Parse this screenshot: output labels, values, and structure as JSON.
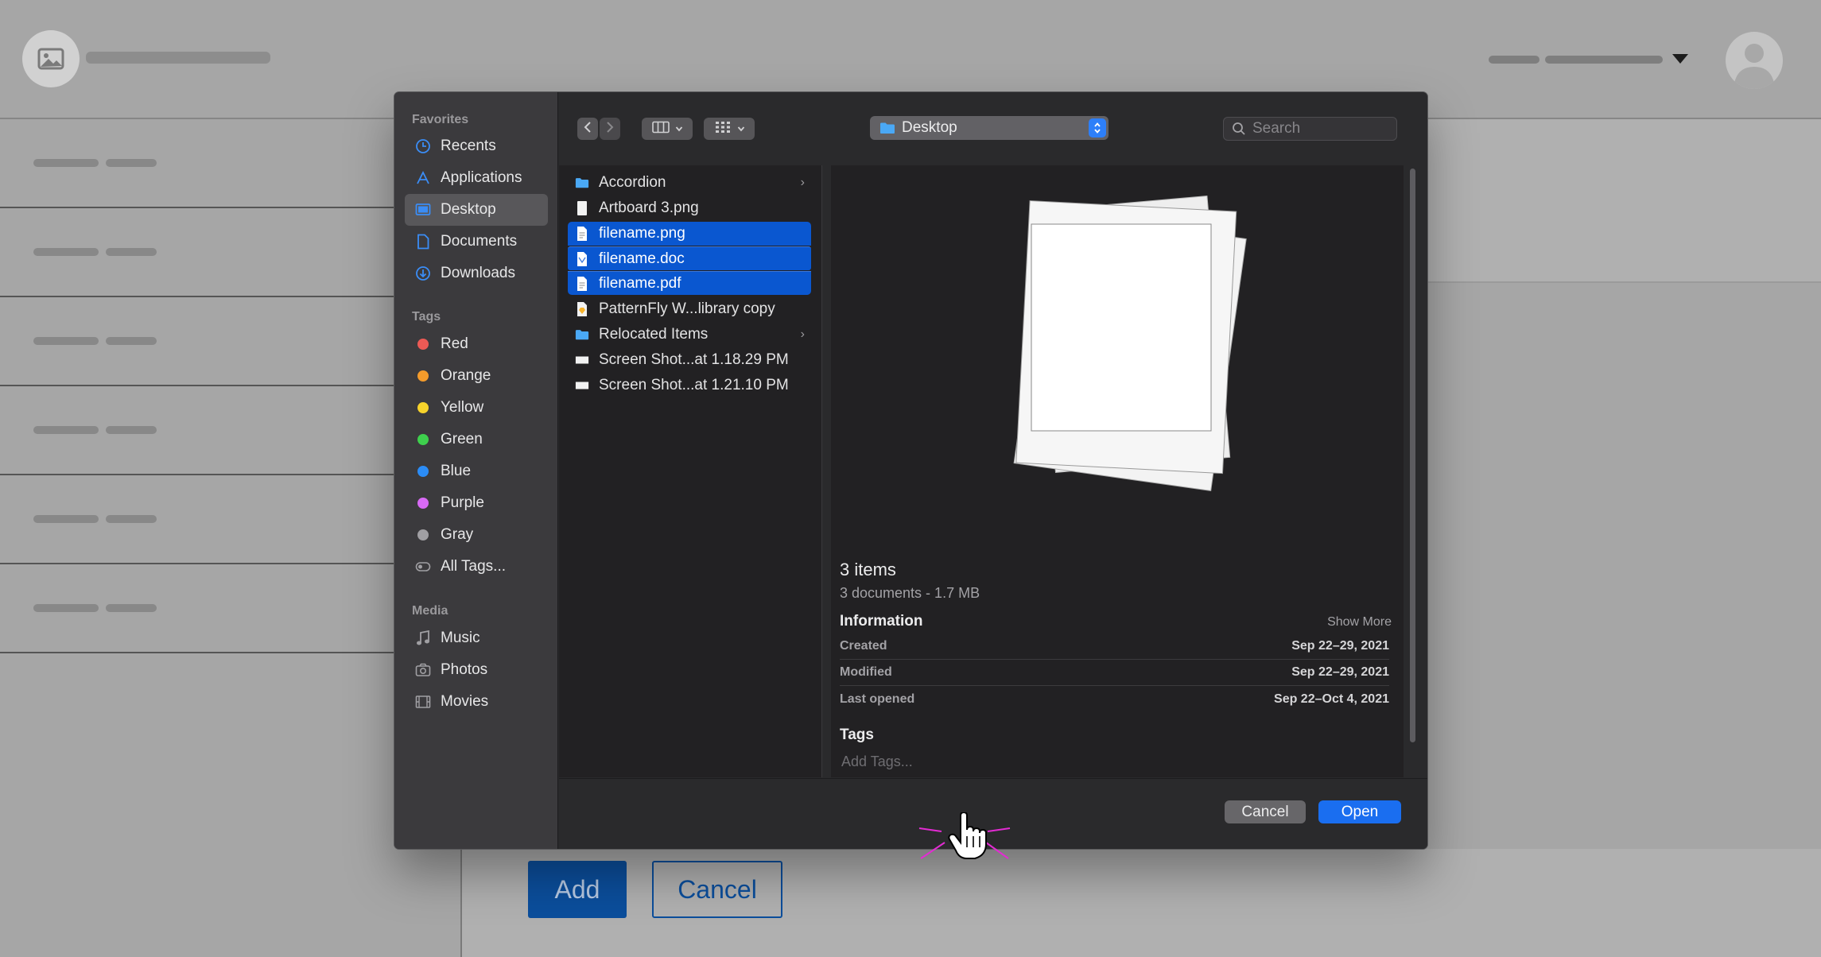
{
  "dialog": {
    "sidebar": {
      "favorites_label": "Favorites",
      "favorites": [
        {
          "label": "Recents",
          "icon": "clock-icon"
        },
        {
          "label": "Applications",
          "icon": "applications-icon"
        },
        {
          "label": "Desktop",
          "icon": "desktop-icon",
          "active": true
        },
        {
          "label": "Documents",
          "icon": "document-icon"
        },
        {
          "label": "Downloads",
          "icon": "download-icon"
        }
      ],
      "tags_label": "Tags",
      "tags": [
        {
          "label": "Red",
          "color": "#ec5a55"
        },
        {
          "label": "Orange",
          "color": "#f49b2b"
        },
        {
          "label": "Yellow",
          "color": "#f7d32b"
        },
        {
          "label": "Green",
          "color": "#3ed04d"
        },
        {
          "label": "Blue",
          "color": "#2b8cf6"
        },
        {
          "label": "Purple",
          "color": "#d86af5"
        },
        {
          "label": "Gray",
          "color": "#a09fa3"
        },
        {
          "label": "All Tags...",
          "icon": "all-tags-icon"
        }
      ],
      "media_label": "Media",
      "media": [
        {
          "label": "Music",
          "icon": "music-icon"
        },
        {
          "label": "Photos",
          "icon": "camera-icon"
        },
        {
          "label": "Movies",
          "icon": "film-icon"
        }
      ]
    },
    "toolbar": {
      "location": "Desktop",
      "search_placeholder": "Search"
    },
    "files": [
      {
        "name": "Accordion",
        "type": "folder",
        "has_children": true
      },
      {
        "name": "Artboard 3.png",
        "type": "image"
      },
      {
        "name": "filename.png",
        "type": "doc",
        "selected": true
      },
      {
        "name": "filename.doc",
        "type": "doc",
        "selected": true
      },
      {
        "name": "filename.pdf",
        "type": "doc",
        "selected": true
      },
      {
        "name": "PatternFly W...library copy",
        "type": "sketch"
      },
      {
        "name": "Relocated Items",
        "type": "folder",
        "has_children": true
      },
      {
        "name": "Screen Shot...at 1.18.29 PM",
        "type": "screenshot"
      },
      {
        "name": "Screen Shot...at 1.21.10 PM",
        "type": "screenshot"
      }
    ],
    "preview": {
      "title": "3 items",
      "subtitle": "3 documents - 1.7 MB",
      "info_label": "Information",
      "show_more": "Show More",
      "rows": [
        {
          "key": "Created",
          "value": "Sep 22–29, 2021"
        },
        {
          "key": "Modified",
          "value": "Sep 22–29, 2021"
        },
        {
          "key": "Last opened",
          "value": "Sep 22–Oct 4, 2021"
        }
      ],
      "tags_label": "Tags",
      "add_tags_placeholder": "Add Tags..."
    },
    "buttons": {
      "cancel": "Cancel",
      "open": "Open"
    }
  },
  "background": {
    "add_button": "Add",
    "cancel_button": "Cancel"
  }
}
